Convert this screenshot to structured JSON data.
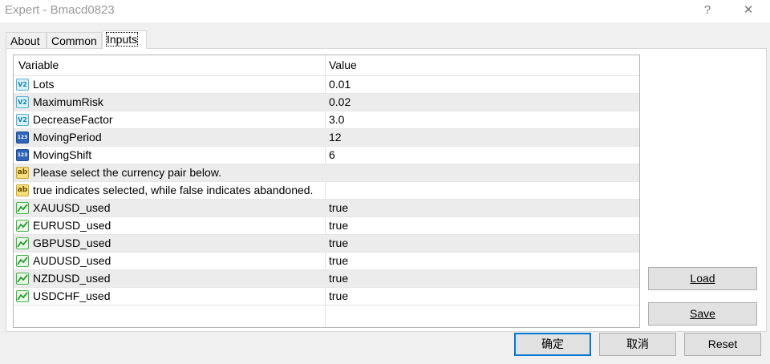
{
  "window": {
    "title": "Expert - Bmacd0823",
    "help_label": "?",
    "close_label": "✕"
  },
  "tabs": [
    {
      "label": "About"
    },
    {
      "label": "Common"
    },
    {
      "label": "Inputs",
      "active": true
    }
  ],
  "grid": {
    "columns": {
      "variable": "Variable",
      "value": "Value"
    },
    "rows": [
      {
        "icon": "double-value-icon",
        "name": "Lots",
        "value": "0.01"
      },
      {
        "icon": "double-value-icon",
        "name": "MaximumRisk",
        "value": "0.02"
      },
      {
        "icon": "double-value-icon",
        "name": "DecreaseFactor",
        "value": "3.0"
      },
      {
        "icon": "integer-value-icon",
        "name": "MovingPeriod",
        "value": "12"
      },
      {
        "icon": "integer-value-icon",
        "name": "MovingShift",
        "value": "6"
      },
      {
        "icon": "string-value-icon",
        "name": "Please select the currency pair below.",
        "value": ""
      },
      {
        "icon": "string-value-icon",
        "name": "true indicates selected, while false indicates abandoned.",
        "value": ""
      },
      {
        "icon": "boolean-value-icon",
        "name": "XAUUSD_used",
        "value": "true"
      },
      {
        "icon": "boolean-value-icon",
        "name": "EURUSD_used",
        "value": "true"
      },
      {
        "icon": "boolean-value-icon",
        "name": "GBPUSD_used",
        "value": "true"
      },
      {
        "icon": "boolean-value-icon",
        "name": "AUDUSD_used",
        "value": "true"
      },
      {
        "icon": "boolean-value-icon",
        "name": "NZDUSD_used",
        "value": "true"
      },
      {
        "icon": "boolean-value-icon",
        "name": "USDCHF_used",
        "value": "true"
      }
    ]
  },
  "side_buttons": {
    "load_label": "Load",
    "save_label": "Save"
  },
  "footer_buttons": {
    "ok_label": "确定",
    "cancel_label": "取消",
    "reset_label": "Reset"
  },
  "colors": {
    "accent": "#0078d7",
    "alt_row": "#ececec"
  }
}
